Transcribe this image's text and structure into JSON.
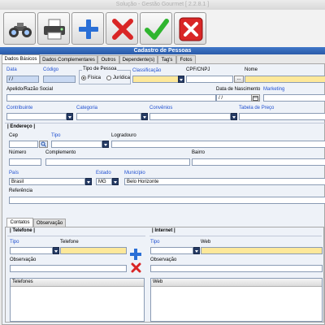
{
  "window": {
    "title": "Solução - Gestão Gourmet [ 2.2.8.1 ]"
  },
  "toolbar": {
    "buttons": [
      {
        "icon": "binoculars-icon"
      },
      {
        "icon": "printer-icon"
      },
      {
        "icon": "plus-icon"
      },
      {
        "icon": "delete-x-icon"
      },
      {
        "icon": "check-icon"
      },
      {
        "icon": "close-icon"
      }
    ]
  },
  "form": {
    "title": "Cadastro de Pessoas"
  },
  "tabs": [
    "Dados Básicos",
    "Dados Complementares",
    "Outros",
    "Dependente(s)",
    "Tag's",
    "Fotos"
  ],
  "fields": {
    "data_label": "Data",
    "data_value": "/ /",
    "codigo_label": "Código",
    "tipo_pessoa_label": "Tipo de Pessoa",
    "fisica_label": "Física",
    "juridica_label": "Jurídica",
    "classificacao_label": "Classificação",
    "cpf_label": "CPF/CNPJ",
    "cpf_btn": "...",
    "nome_label": "Nome",
    "apelido_label": "Apelido/Razão Social",
    "nascimento_label": "Data de Nascimento",
    "nascimento_value": "/ /",
    "marketing_label": "Marketing",
    "contribuinte_label": "Contribuinte",
    "categoria_label": "Categoria",
    "convenios_label": "Convênios",
    "tabela_label": "Tabela de Preço",
    "endereco_label": "| Endereço |",
    "cep_label": "Cep",
    "tipo_label": "Tipo",
    "logradouro_label": "Logradouro",
    "numero_label": "Número",
    "complemento_label": "Complemento",
    "bairro_label": "Bairro",
    "pais_label": "País",
    "pais_value": "Brasil",
    "estado_label": "Estado",
    "estado_value": "MG",
    "municipio_label": "Município",
    "municipio_value": "Belo Horizonte",
    "referencia_label": "Referência"
  },
  "subtabs": [
    "Contatos",
    "Observação"
  ],
  "telefone": {
    "group_label": "| Telefone |",
    "tipo_label": "Tipo",
    "telefone_label": "Telefone",
    "obs_label": "Observação",
    "grid_header": "Telefones"
  },
  "internet": {
    "group_label": "| Internet |",
    "tipo_label": "Tipo",
    "web_label": "Web",
    "obs_label": "Observação",
    "grid_header": "Web"
  }
}
